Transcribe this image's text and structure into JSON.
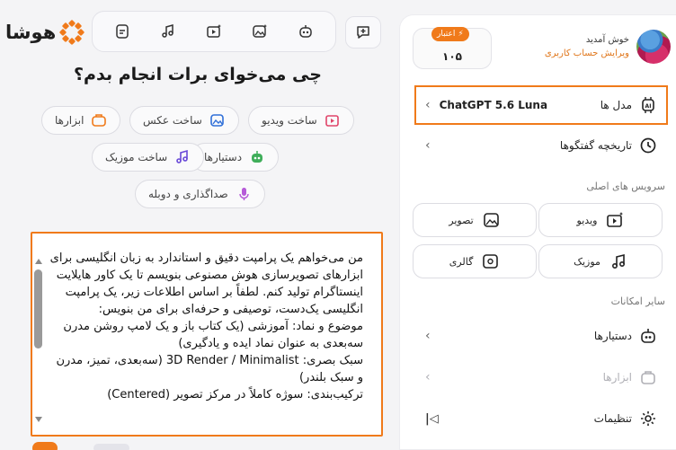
{
  "brand": {
    "name": "هوشا",
    "accent": "#f07a1a"
  },
  "toolbar": {
    "icons": [
      "document-icon",
      "music-sparkle-icon",
      "video-sparkle-icon",
      "image-sparkle-icon",
      "robot-icon"
    ],
    "new_chat_icon": "new-chat-icon"
  },
  "main": {
    "headline": "چی می‌خوای برات انجام بدم؟",
    "chips": [
      {
        "label": "ساخت ویدیو",
        "icon": "video-icon"
      },
      {
        "label": "ساخت عکس",
        "icon": "image-icon"
      },
      {
        "label": "ابزارها",
        "icon": "tools-icon"
      },
      {
        "label": "دستیارها",
        "icon": "robot-icon"
      },
      {
        "label": "ساخت موزیک",
        "icon": "music-icon"
      },
      {
        "label": "صداگذاری و دوبله",
        "icon": "microphone-icon"
      }
    ],
    "prompt_text": "من می‌خواهم یک پرامپت دقیق و استاندارد به زبان انگلیسی برای ابزارهای تصویرسازی هوش مصنوعی بنویسم تا یک کاور هایلایت اینستاگرام تولید کنم. لطفاً بر اساس اطلاعات زیر، یک پرامپت انگلیسی یک‌دست، توصیفی و حرفه‌ای برای من بنویس:\nموضوع و نماد: آموزشی (یک کتاب باز و یک لامپ روشن مدرن سه‌بعدی به عنوان نماد ایده و یادگیری)\nسبک بصری: 3D Render / Minimalist (سه‌بعدی، تمیز، مدرن و سبک بلندر)\nترکیب‌بندی: سوژه کاملاً در مرکز تصویر (Centered)"
  },
  "sidebar": {
    "profile": {
      "greeting": "خوش آمدید",
      "edit_label": "ویرایش حساب کاربری"
    },
    "credit": {
      "label": "اعتبار",
      "value": "۱۰۵"
    },
    "model": {
      "label": "مدل ها",
      "value": "ChatGPT 5.6 Luna"
    },
    "history_label": "تاریخچه گفتگوها",
    "main_services_title": "سرویس های اصلی",
    "services": [
      {
        "label": "ویدیو",
        "icon": "video-icon"
      },
      {
        "label": "تصویر",
        "icon": "image-icon"
      },
      {
        "label": "موزیک",
        "icon": "music-icon"
      },
      {
        "label": "گالری",
        "icon": "gallery-icon"
      }
    ],
    "other_title": "سایر امکانات",
    "assistants_label": "دستیارها",
    "tools_label": "ابزارها",
    "settings_label": "تنظیمات",
    "collapse_glyph": "|◁"
  }
}
